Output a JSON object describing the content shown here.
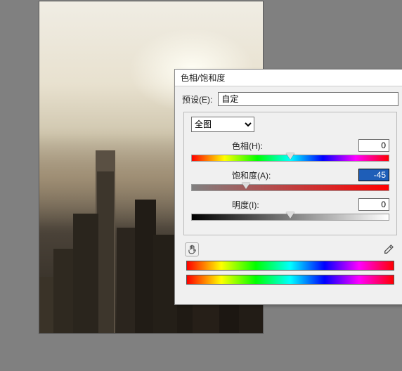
{
  "dialog": {
    "title": "色相/饱和度",
    "preset_label": "预设(E):",
    "preset_value": "自定",
    "channel_value": "全图",
    "params": {
      "hue": {
        "label": "色相(H):",
        "value": "0",
        "percent": 50
      },
      "saturation": {
        "label": "饱和度(A):",
        "value": "-45",
        "percent": 27.5,
        "selected": true
      },
      "lightness": {
        "label": "明度(I):",
        "value": "0",
        "percent": 50
      }
    }
  }
}
